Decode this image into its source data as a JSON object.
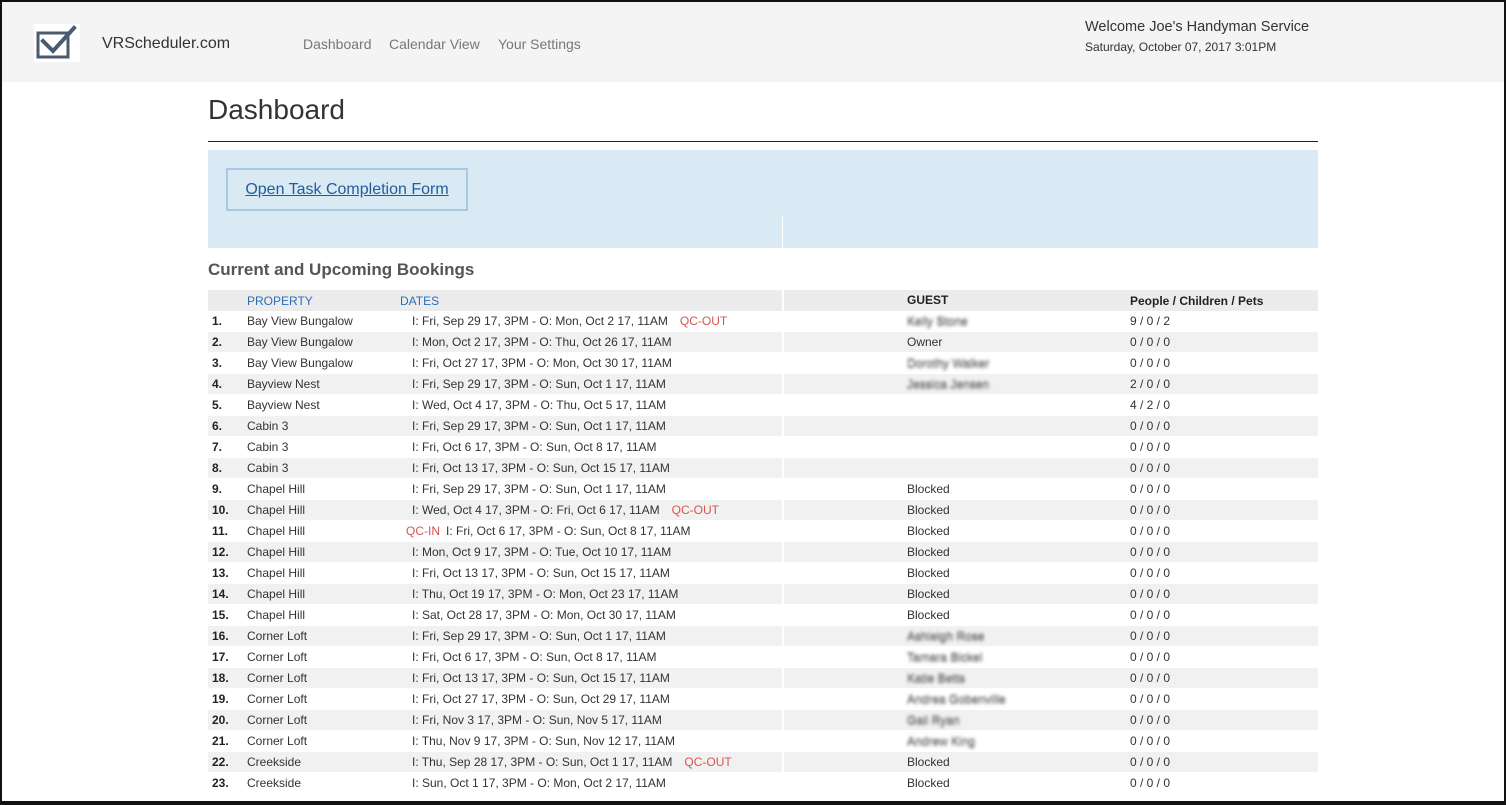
{
  "header": {
    "brand": "VRScheduler.com",
    "nav": [
      "Dashboard",
      "Calendar View",
      "Your Settings"
    ],
    "welcome": "Welcome Joe's Handyman Service",
    "datetime": "Saturday, October 07, 2017 3:01PM",
    "logo_icon": "checkmark-box-icon"
  },
  "page": {
    "title": "Dashboard",
    "open_form_button": "Open Task Completion Form"
  },
  "bookings": {
    "section_title": "Current and Upcoming Bookings",
    "columns": {
      "property": "PROPERTY",
      "dates": "DATES",
      "guest": "GUEST",
      "people": "People / Children / Pets"
    },
    "rows": [
      {
        "num": "1.",
        "property": "Bay View Bungalow",
        "pre_tag": "",
        "dates": "I: Fri, Sep 29 17, 3PM - O: Mon, Oct 2 17, 11AM",
        "post_tag": "QC-OUT",
        "guest": "Kelly Stone",
        "guest_blurred": true,
        "pcp": "9 / 0 / 2"
      },
      {
        "num": "2.",
        "property": "Bay View Bungalow",
        "pre_tag": "",
        "dates": "I: Mon, Oct 2 17, 3PM - O: Thu, Oct 26 17, 11AM",
        "post_tag": "",
        "guest": "Owner",
        "guest_blurred": false,
        "pcp": "0 / 0 / 0"
      },
      {
        "num": "3.",
        "property": "Bay View Bungalow",
        "pre_tag": "",
        "dates": "I: Fri, Oct 27 17, 3PM - O: Mon, Oct 30 17, 11AM",
        "post_tag": "",
        "guest": "Dorothy Walker",
        "guest_blurred": true,
        "pcp": "0 / 0 / 0"
      },
      {
        "num": "4.",
        "property": "Bayview Nest",
        "pre_tag": "",
        "dates": "I: Fri, Sep 29 17, 3PM - O: Sun, Oct 1 17, 11AM",
        "post_tag": "",
        "guest": "Jessica Jensen",
        "guest_blurred": true,
        "pcp": "2 / 0 / 0"
      },
      {
        "num": "5.",
        "property": "Bayview Nest",
        "pre_tag": "",
        "dates": "I: Wed, Oct 4 17, 3PM - O: Thu, Oct 5 17, 11AM",
        "post_tag": "",
        "guest": "",
        "guest_blurred": false,
        "pcp": "4 / 2 / 0"
      },
      {
        "num": "6.",
        "property": "Cabin 3",
        "pre_tag": "",
        "dates": "I: Fri, Sep 29 17, 3PM - O: Sun, Oct 1 17, 11AM",
        "post_tag": "",
        "guest": "",
        "guest_blurred": false,
        "pcp": "0 / 0 / 0"
      },
      {
        "num": "7.",
        "property": "Cabin 3",
        "pre_tag": "",
        "dates": "I: Fri, Oct 6 17, 3PM - O: Sun, Oct 8 17, 11AM",
        "post_tag": "",
        "guest": "",
        "guest_blurred": false,
        "pcp": "0 / 0 / 0"
      },
      {
        "num": "8.",
        "property": "Cabin 3",
        "pre_tag": "",
        "dates": "I: Fri, Oct 13 17, 3PM - O: Sun, Oct 15 17, 11AM",
        "post_tag": "",
        "guest": "",
        "guest_blurred": false,
        "pcp": "0 / 0 / 0"
      },
      {
        "num": "9.",
        "property": "Chapel Hill",
        "pre_tag": "",
        "dates": "I: Fri, Sep 29 17, 3PM - O: Sun, Oct 1 17, 11AM",
        "post_tag": "",
        "guest": "Blocked",
        "guest_blurred": false,
        "pcp": "0 / 0 / 0"
      },
      {
        "num": "10.",
        "property": "Chapel Hill",
        "pre_tag": "",
        "dates": "I: Wed, Oct 4 17, 3PM - O: Fri, Oct 6 17, 11AM",
        "post_tag": "QC-OUT",
        "guest": "Blocked",
        "guest_blurred": false,
        "pcp": "0 / 0 / 0"
      },
      {
        "num": "11.",
        "property": "Chapel Hill",
        "pre_tag": "QC-IN",
        "dates": "I: Fri, Oct 6 17, 3PM - O: Sun, Oct 8 17, 11AM",
        "post_tag": "",
        "guest": "Blocked",
        "guest_blurred": false,
        "pcp": "0 / 0 / 0"
      },
      {
        "num": "12.",
        "property": "Chapel Hill",
        "pre_tag": "",
        "dates": "I: Mon, Oct 9 17, 3PM - O: Tue, Oct 10 17, 11AM",
        "post_tag": "",
        "guest": "Blocked",
        "guest_blurred": false,
        "pcp": "0 / 0 / 0"
      },
      {
        "num": "13.",
        "property": "Chapel Hill",
        "pre_tag": "",
        "dates": "I: Fri, Oct 13 17, 3PM - O: Sun, Oct 15 17, 11AM",
        "post_tag": "",
        "guest": "Blocked",
        "guest_blurred": false,
        "pcp": "0 / 0 / 0"
      },
      {
        "num": "14.",
        "property": "Chapel Hill",
        "pre_tag": "",
        "dates": "I: Thu, Oct 19 17, 3PM - O: Mon, Oct 23 17, 11AM",
        "post_tag": "",
        "guest": "Blocked",
        "guest_blurred": false,
        "pcp": "0 / 0 / 0"
      },
      {
        "num": "15.",
        "property": "Chapel Hill",
        "pre_tag": "",
        "dates": "I: Sat, Oct 28 17, 3PM - O: Mon, Oct 30 17, 11AM",
        "post_tag": "",
        "guest": "Blocked",
        "guest_blurred": false,
        "pcp": "0 / 0 / 0"
      },
      {
        "num": "16.",
        "property": "Corner Loft",
        "pre_tag": "",
        "dates": "I: Fri, Sep 29 17, 3PM - O: Sun, Oct 1 17, 11AM",
        "post_tag": "",
        "guest": "Ashleigh Rose",
        "guest_blurred": true,
        "pcp": "0 / 0 / 0"
      },
      {
        "num": "17.",
        "property": "Corner Loft",
        "pre_tag": "",
        "dates": "I: Fri, Oct 6 17, 3PM - O: Sun, Oct 8 17, 11AM",
        "post_tag": "",
        "guest": "Tamara Bickel",
        "guest_blurred": true,
        "pcp": "0 / 0 / 0"
      },
      {
        "num": "18.",
        "property": "Corner Loft",
        "pre_tag": "",
        "dates": "I: Fri, Oct 13 17, 3PM - O: Sun, Oct 15 17, 11AM",
        "post_tag": "",
        "guest": "Katie Betts",
        "guest_blurred": true,
        "pcp": "0 / 0 / 0"
      },
      {
        "num": "19.",
        "property": "Corner Loft",
        "pre_tag": "",
        "dates": "I: Fri, Oct 27 17, 3PM - O: Sun, Oct 29 17, 11AM",
        "post_tag": "",
        "guest": "Andrea Gobenville",
        "guest_blurred": true,
        "pcp": "0 / 0 / 0"
      },
      {
        "num": "20.",
        "property": "Corner Loft",
        "pre_tag": "",
        "dates": "I: Fri, Nov 3 17, 3PM - O: Sun, Nov 5 17, 11AM",
        "post_tag": "",
        "guest": "Gail Ryan",
        "guest_blurred": true,
        "pcp": "0 / 0 / 0"
      },
      {
        "num": "21.",
        "property": "Corner Loft",
        "pre_tag": "",
        "dates": "I: Thu, Nov 9 17, 3PM - O: Sun, Nov 12 17, 11AM",
        "post_tag": "",
        "guest": "Andrew King",
        "guest_blurred": true,
        "pcp": "0 / 0 / 0"
      },
      {
        "num": "22.",
        "property": "Creekside",
        "pre_tag": "",
        "dates": "I: Thu, Sep 28 17, 3PM - O: Sun, Oct 1 17, 11AM",
        "post_tag": "QC-OUT",
        "guest": "Blocked",
        "guest_blurred": false,
        "pcp": "0 / 0 / 0"
      },
      {
        "num": "23.",
        "property": "Creekside",
        "pre_tag": "",
        "dates": "I: Sun, Oct 1 17, 3PM - O: Mon, Oct 2 17, 11AM",
        "post_tag": "",
        "guest": "Blocked",
        "guest_blurred": false,
        "pcp": "0 / 0 / 0"
      }
    ]
  }
}
